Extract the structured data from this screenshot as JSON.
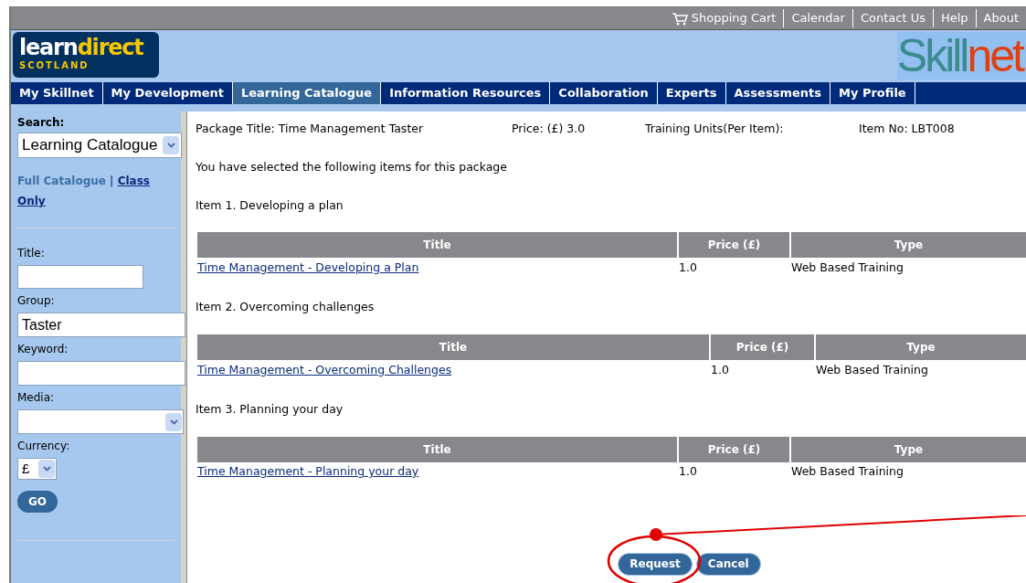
{
  "top_links": [
    {
      "label": "Shopping Cart",
      "kind": "cart"
    },
    {
      "label": "Calendar",
      "kind": "link"
    },
    {
      "label": "Contact Us",
      "kind": "link"
    },
    {
      "label": "Help",
      "kind": "link"
    },
    {
      "label": "About",
      "kind": "link"
    }
  ],
  "logo": {
    "word_a": "learn",
    "word_b": "direct",
    "sub": "SCOTLAND"
  },
  "brand": {
    "part_a": "Skill",
    "part_b": "net"
  },
  "nav": [
    {
      "label": "My Skillnet",
      "selected": false
    },
    {
      "label": "My Development",
      "selected": false
    },
    {
      "label": "Learning Catalogue",
      "selected": true
    },
    {
      "label": "Information Resources",
      "selected": false
    },
    {
      "label": "Collaboration",
      "selected": false
    },
    {
      "label": "Experts",
      "selected": false
    },
    {
      "label": "Assessments",
      "selected": false
    },
    {
      "label": "My Profile",
      "selected": false
    }
  ],
  "sidebar": {
    "search_label": "Search:",
    "search_value": "Learning Catalogue",
    "scope_a": "Full Catalogue",
    "scope_sep": "|",
    "scope_b": [
      "Class",
      "Only"
    ],
    "fields": [
      {
        "label": "Title:",
        "kind": "short"
      },
      {
        "label": "Group:",
        "kind": "text",
        "value": "Taster"
      },
      {
        "label": "Keyword:",
        "kind": "text"
      },
      {
        "label": "Media:",
        "kind": "select"
      },
      {
        "label": "Currency:",
        "kind": "currency",
        "value": "£"
      }
    ],
    "go": "GO"
  },
  "package": {
    "title": "Package Title: Time Management Taster",
    "price": "Price: (£) 3.0",
    "units": "Training Units(Per Item):",
    "item_no": "Item No: LBT008"
  },
  "intro": "You have selected the following items for this package",
  "items": [
    {
      "heading": "Item 1. Developing a plan",
      "columns": [
        "Title",
        "Price (£)",
        "Type"
      ],
      "row": [
        "Time Management - Developing a Plan",
        "1.0",
        "Web Based Training"
      ]
    },
    {
      "heading": "Item 2. Overcoming challenges",
      "columns": [
        "Title",
        "Price (£)",
        "Type"
      ],
      "row": [
        "Time Management - Overcoming Challenges",
        "1.0",
        "Web Based Training"
      ]
    },
    {
      "heading": "Item 3. Planning your day",
      "columns": [
        "Title",
        "Price (£)",
        "Type"
      ],
      "row": [
        "Time Management - Planning your day",
        "1.0",
        "Web Based Training"
      ]
    }
  ],
  "buttons": [
    "Request",
    "Cancel"
  ]
}
